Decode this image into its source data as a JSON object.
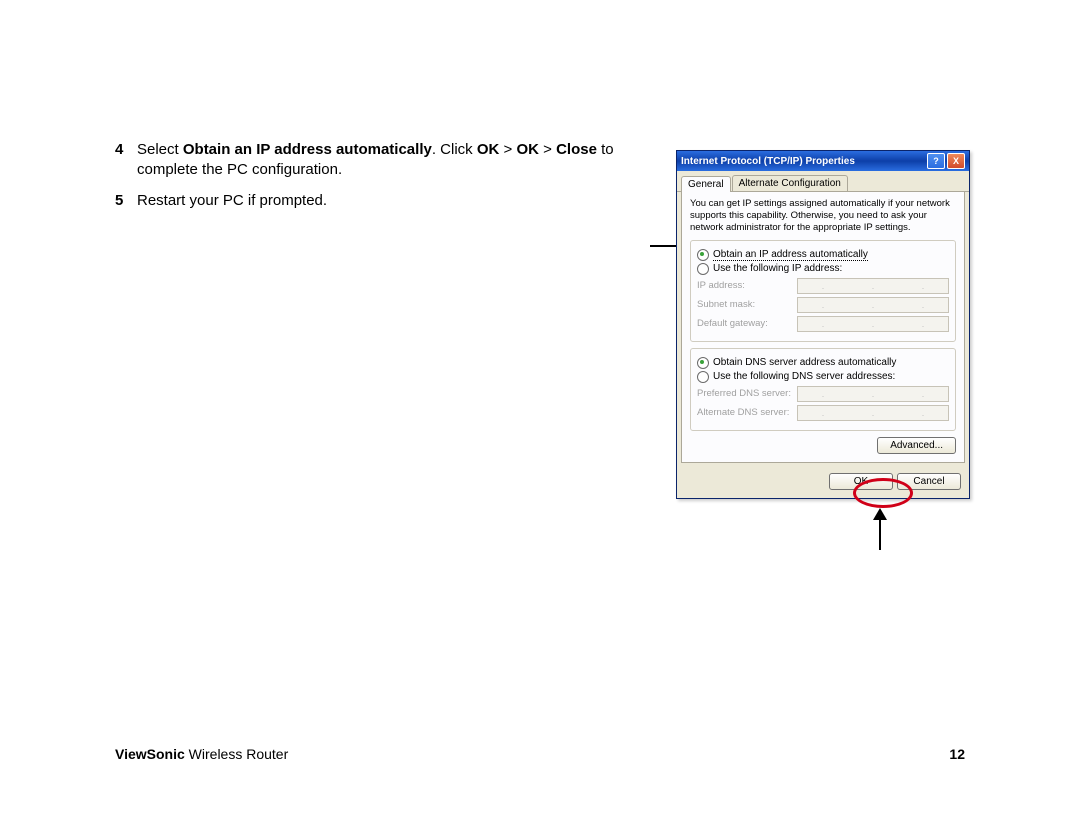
{
  "steps": [
    {
      "num": "4",
      "html": "Select <b>Obtain an IP address automatically</b>. Click <b>OK</b> > <b>OK</b> > <b>Close</b> to complete the PC configuration."
    },
    {
      "num": "5",
      "text": "Restart your PC if prompted."
    }
  ],
  "footer": {
    "brand": "ViewSonic",
    "product": " Wireless Router",
    "page": "12"
  },
  "dialog": {
    "title": "Internet Protocol (TCP/IP) Properties",
    "help_icon": "?",
    "close_icon": "X",
    "tabs": {
      "general": "General",
      "alt": "Alternate Configuration"
    },
    "info": "You can get IP settings assigned automatically if your network supports this capability. Otherwise, you need to ask your network administrator for the appropriate IP settings.",
    "ip": {
      "auto": "Obtain an IP address automatically",
      "manual": "Use the following IP address:",
      "fields": {
        "ip": "IP address:",
        "subnet": "Subnet mask:",
        "gateway": "Default gateway:"
      }
    },
    "dns": {
      "auto": "Obtain DNS server address automatically",
      "manual": "Use the following DNS server addresses:",
      "fields": {
        "preferred": "Preferred DNS server:",
        "alternate": "Alternate DNS server:"
      }
    },
    "advanced": "Advanced...",
    "ok": "OK",
    "cancel": "Cancel"
  }
}
